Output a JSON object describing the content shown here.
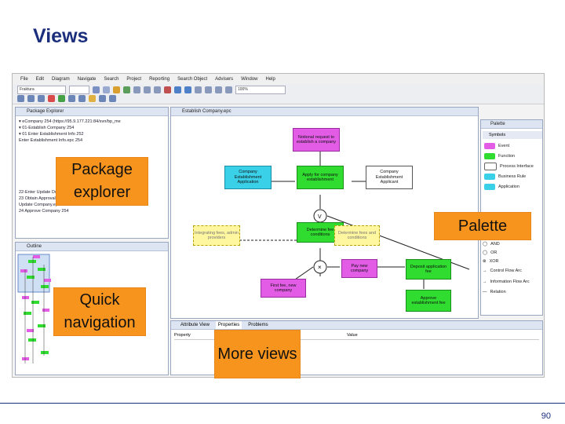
{
  "slide": {
    "title": "Views",
    "page_number": "90"
  },
  "colors": {
    "title": "#1c2f7d",
    "annotation": "#f7941d",
    "function": "#2fdc2f",
    "event": "#e25ce6",
    "application": "#3ad0e8"
  },
  "menubar": [
    "File",
    "Edit",
    "Diagram",
    "Navigate",
    "Search",
    "Project",
    "Reporting",
    "Search Object",
    "Advisers",
    "Window",
    "Help"
  ],
  "toolbar": {
    "combo_left": "Fraktura",
    "zoom": "100%"
  },
  "package_explorer": {
    "tab": "Package Explorer",
    "items": [
      "▾ eCompany 254 (https://95.9.177.221:84/svn/bp_me",
      "  ▾ 01-Establish Company 254",
      "    ▾ 01 Enter Establishment Info 252",
      "        Enter Establishment Info.epc 254",
      "    22-Enter Update Docs 252",
      "    23 Obtain Approval 252",
      "    Update Company.epc 254",
      "  24 Approve Company 254"
    ]
  },
  "editor": {
    "tab": "Establish Company.epc",
    "nodes": {
      "ev_top": "Notional request to establish a company",
      "ap_left": "Company Establishment Application",
      "fn_apply": "Apply for company establishment",
      "pr_right": "Company Establishment Applicant",
      "ca_left": "Integrating fees, admin providers",
      "fn_determine": "Determine fee conditions",
      "ca_right": "Determine fees and conditions",
      "ev_pay": "Pay new company",
      "ev_first": "First fee, new company",
      "fn_deposit": "Deposit application fee",
      "fn_approve": "Approve establishment fee"
    },
    "connector_x": "×",
    "connector_v": "V"
  },
  "palette": {
    "tab": "Palette",
    "section": "Symbols",
    "items": [
      {
        "label": "Event",
        "color": "#e25ce6"
      },
      {
        "label": "Function",
        "color": "#2fdc2f"
      },
      {
        "label": "Process Interface",
        "color": "#ffffff"
      },
      {
        "label": "Business Rule",
        "color": "#3ad0e8"
      },
      {
        "label": "Application",
        "color": "#3ad0e8"
      }
    ],
    "lower": [
      "AND",
      "OR",
      "XOR",
      "Control Flow Arc",
      "Information Flow Arc",
      "Relation"
    ]
  },
  "outline": {
    "tab": "Outline"
  },
  "bottom_tabs": {
    "attribute_view": "Attribute View",
    "properties": "Properties",
    "problems": "Problems"
  },
  "properties_table": {
    "col_property": "Property",
    "col_value": "Value"
  },
  "annotations": {
    "package_explorer": "Package explorer",
    "palette": "Palette",
    "quick_navigation": "Quick navigation",
    "more_views": "More views"
  }
}
